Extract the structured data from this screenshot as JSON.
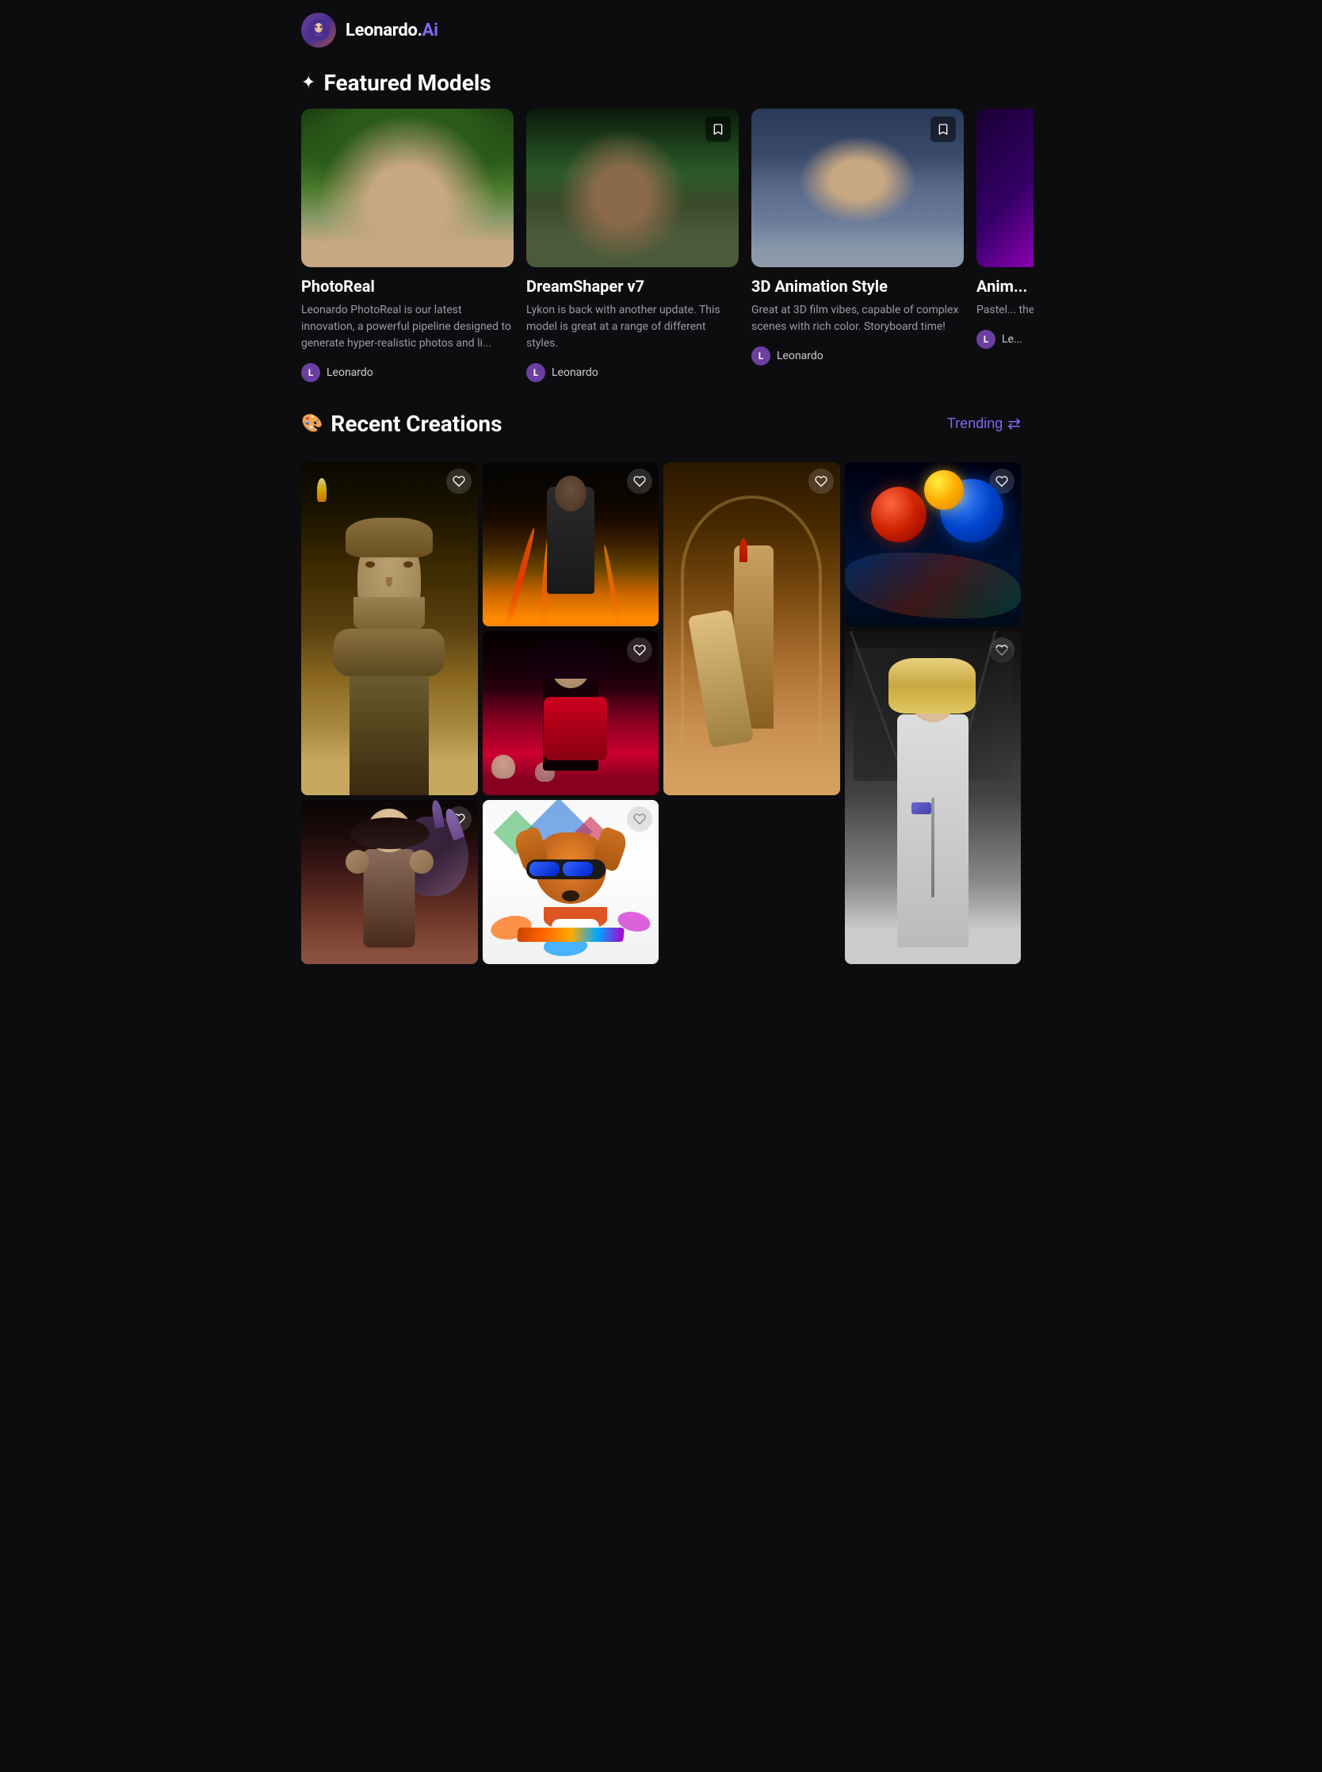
{
  "header": {
    "logo_text_white": "Leonardo.",
    "logo_text_purple": "Ai"
  },
  "featured_section": {
    "icon": "✦",
    "title": "Featured Models",
    "models": [
      {
        "id": "photoreal",
        "name": "PhotoReal",
        "description": "Leonardo PhotoReal is our latest innovation, a powerful pipeline designed to generate hyper-realistic photos and li...",
        "author": "Leonardo",
        "author_initial": "L",
        "image_class": "img-elf-woman mc1"
      },
      {
        "id": "dreamshaper",
        "name": "DreamShaper v7",
        "description": "Lykon is back with another update. This model is great at a range of different styles.",
        "author": "Leonardo",
        "author_initial": "L",
        "image_class": "img-warrior mc2"
      },
      {
        "id": "3d-animation",
        "name": "3D Animation Style",
        "description": "Great at 3D film vibes, capable of complex scenes with rich color. Storyboard time!",
        "author": "Leonardo",
        "author_initial": "L",
        "image_class": "img-old-man mc3"
      },
      {
        "id": "anime",
        "name": "Anim...",
        "description": "Pastel... the ani... Model...",
        "author": "Le...",
        "author_initial": "L",
        "image_class": "mc4"
      }
    ]
  },
  "recent_section": {
    "icon": "🎨",
    "title": "Recent Creations",
    "trending_label": "Trending",
    "items": [
      {
        "id": "statue",
        "image_class": "img-statue c1",
        "tall": true,
        "emoji": ""
      },
      {
        "id": "fire-man",
        "image_class": "img-fire-man c2",
        "tall": false,
        "emoji": ""
      },
      {
        "id": "warriors",
        "image_class": "img-warriors-fight c3",
        "tall": true,
        "emoji": ""
      },
      {
        "id": "colorful-balls",
        "image_class": "img-colorful-balls c4",
        "tall": false,
        "emoji": ""
      },
      {
        "id": "dark-girl",
        "image_class": "img-dark-girl c5",
        "tall": false,
        "emoji": ""
      },
      {
        "id": "blonde-girl",
        "image_class": "img-blonde-girl c6",
        "tall": true,
        "emoji": ""
      },
      {
        "id": "dragon-girl",
        "image_class": "img-dragon-girl c7",
        "tall": false,
        "emoji": ""
      },
      {
        "id": "dog",
        "image_class": "img-dog c8",
        "tall": false,
        "emoji": ""
      }
    ]
  }
}
